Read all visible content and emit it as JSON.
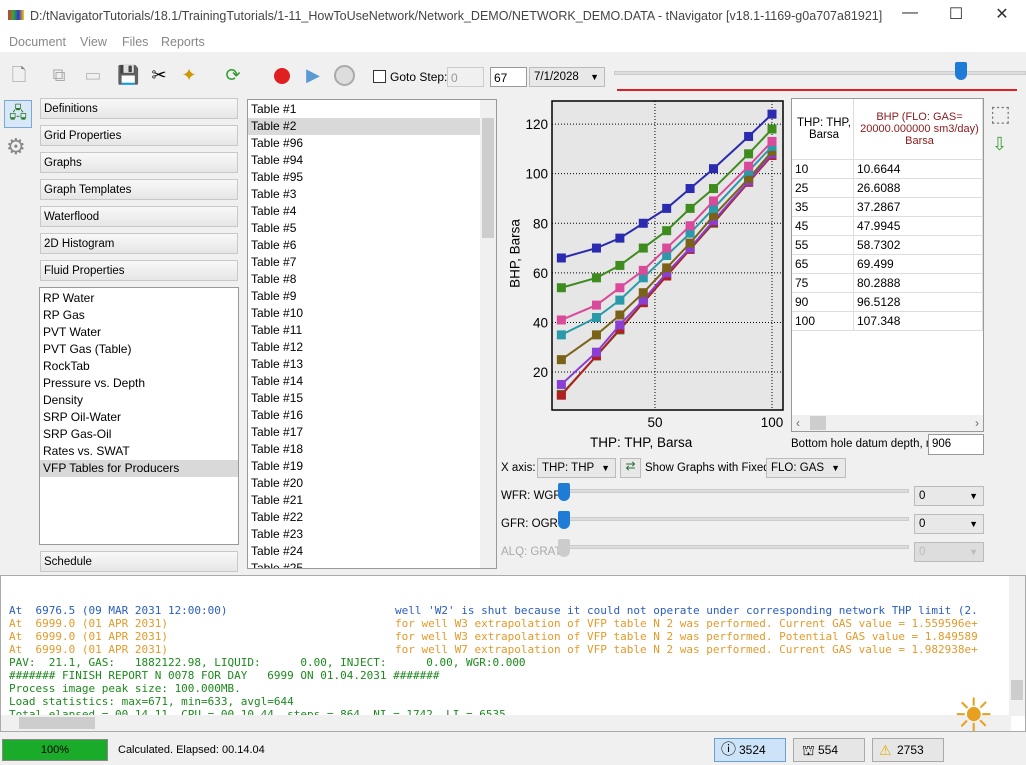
{
  "window": {
    "title": "D:/tNavigatorTutorials/18.1/TrainingTutorials/1-11_HowToUseNetwork/Network_DEMO/NETWORK_DEMO.DATA - tNavigator [v18.1-1169-g0a707a81921]"
  },
  "menu": [
    "Document",
    "View",
    "Files",
    "Reports"
  ],
  "toolbar": {
    "goto_step_label": "Goto Step:",
    "goto_step_value": "0",
    "step_value": "67",
    "date": "7/1/2028"
  },
  "left_panel": {
    "sections": [
      "Definitions",
      "Grid Properties",
      "Graphs",
      "Graph Templates",
      "Waterflood",
      "2D Histogram",
      "Fluid Properties"
    ],
    "fluid_items": [
      "RP Water",
      "RP Gas",
      "PVT Water",
      "PVT Gas (Table)",
      "RockTab",
      "Pressure vs. Depth",
      "Density",
      "SRP Oil-Water",
      "SRP Gas-Oil",
      "Rates vs. SWAT",
      "VFP Tables for Producers"
    ],
    "selected_item": "VFP Tables for Producers",
    "schedule": "Schedule"
  },
  "tables": [
    "Table #1",
    "Table #2",
    "Table #96",
    "Table #94",
    "Table #95",
    "Table #3",
    "Table #4",
    "Table #5",
    "Table #6",
    "Table #7",
    "Table #8",
    "Table #9",
    "Table #10",
    "Table #11",
    "Table #12",
    "Table #13",
    "Table #14",
    "Table #15",
    "Table #16",
    "Table #17",
    "Table #18",
    "Table #19",
    "Table #20",
    "Table #21",
    "Table #22",
    "Table #23",
    "Table #24",
    "Table #25"
  ],
  "selected_table": "Table #2",
  "chart_data": {
    "type": "line",
    "xlabel": "THP: THP, Barsa",
    "ylabel": "BHP, Barsa",
    "xlim": [
      6,
      104.7
    ],
    "ylim": [
      4.7,
      129.3
    ],
    "xticks": [
      50,
      100
    ],
    "yticks": [
      20,
      40,
      60,
      80,
      100,
      120
    ],
    "grid": true,
    "x": [
      10,
      25,
      35,
      45,
      55,
      65,
      75,
      90,
      100
    ],
    "series": [
      {
        "color": "#2b2bb0",
        "values": [
          66,
          70,
          74,
          80,
          86,
          94,
          102,
          115,
          124
        ]
      },
      {
        "color": "#3e8c1e",
        "values": [
          54,
          58,
          63,
          70,
          77,
          86,
          94,
          108,
          118
        ]
      },
      {
        "color": "#d94a9a",
        "values": [
          41,
          47,
          54,
          61,
          70,
          79,
          89,
          103,
          113
        ]
      },
      {
        "color": "#2a9aaa",
        "values": [
          35,
          42,
          49,
          58,
          67,
          76,
          86,
          101,
          111
        ]
      },
      {
        "color": "#7a6218",
        "values": [
          25,
          35,
          43,
          52,
          62,
          72,
          83,
          98,
          109
        ]
      },
      {
        "color": "#8a3ed4",
        "values": [
          15,
          28,
          39,
          49,
          60,
          70,
          81,
          97,
          108
        ]
      },
      {
        "color": "#b02020",
        "values": [
          10.6644,
          26.6088,
          37.2867,
          47.9945,
          58.7302,
          69.499,
          80.2888,
          96.5128,
          107.348
        ]
      },
      {
        "color": "#2f8f2f",
        "values": [
          11,
          26.5,
          37,
          48,
          59,
          69.5,
          80,
          96.8,
          107.5
        ]
      }
    ]
  },
  "vfp_table": {
    "col1": "THP: THP, Barsa",
    "col2": "BHP (FLO: GAS= 20000.000000 sm3/day) Barsa",
    "rows": [
      [
        "10",
        "10.6644"
      ],
      [
        "25",
        "26.6088"
      ],
      [
        "35",
        "37.2867"
      ],
      [
        "45",
        "47.9945"
      ],
      [
        "55",
        "58.7302"
      ],
      [
        "65",
        "69.499"
      ],
      [
        "75",
        "80.2888"
      ],
      [
        "90",
        "96.5128"
      ],
      [
        "100",
        "107.348"
      ]
    ]
  },
  "depth": {
    "label": "Bottom hole datum depth, m",
    "value": "906"
  },
  "controls": {
    "x_axis_label": "X axis:",
    "x_axis_value": "THP: THP",
    "fixed_label": "Show Graphs with Fixed:",
    "fixed_value": "FLO: GAS",
    "sliders": [
      {
        "label": "WFR: WGR",
        "value": "0"
      },
      {
        "label": "GFR: OGR",
        "value": "0"
      },
      {
        "label": "ALQ: GRAT",
        "value": "0"
      }
    ]
  },
  "log": [
    {
      "c": "blue",
      "t": "At  6976.5 (09 MAR 2031 12:00:00)",
      "m": "well 'W2' is shut because it could not operate under corresponding network THP limit (2."
    },
    {
      "c": "orange",
      "t": "At  6999.0 (01 APR 2031)",
      "m": "for well W3 extrapolation of VFP table N 2 was performed. Current GAS value = 1.559596e+"
    },
    {
      "c": "orange",
      "t": "At  6999.0 (01 APR 2031)",
      "m": "for well W3 extrapolation of VFP table N 2 was performed. Potential GAS value = 1.849589"
    },
    {
      "c": "orange",
      "t": "At  6999.0 (01 APR 2031)",
      "m": "for well W7 extrapolation of VFP table N 2 was performed. Current GAS value = 1.982938e+"
    },
    {
      "c": "green",
      "t": "PAV:  21.1, GAS:   1882122.98, LIQUID:      0.00, INJECT:      0.00, WGR:0.000",
      "m": ""
    },
    {
      "c": "green",
      "t": "####### FINISH REPORT N 0078 FOR DAY   6999 ON 01.04.2031 #######",
      "m": ""
    },
    {
      "c": "green",
      "t": "Process image peak size: 100.000MB.",
      "m": ""
    },
    {
      "c": "green",
      "t": "Load statistics: max=671, min=633, avgl=644",
      "m": ""
    },
    {
      "c": "green",
      "t": "Total elapsed = 00.14.11, CPU = 00.10.44, steps = 864, NI = 1742, LI = 6535",
      "m": ""
    }
  ],
  "status": {
    "progress": "100%",
    "progress_value": 100,
    "message": "Calculated. Elapsed: 00.14.04",
    "info_count": "3524",
    "well_count": "554",
    "warning_count": "2753"
  },
  "colors": {
    "progress": "#1aab2a",
    "record": "#e02020",
    "accent": "#1e7bd6"
  }
}
